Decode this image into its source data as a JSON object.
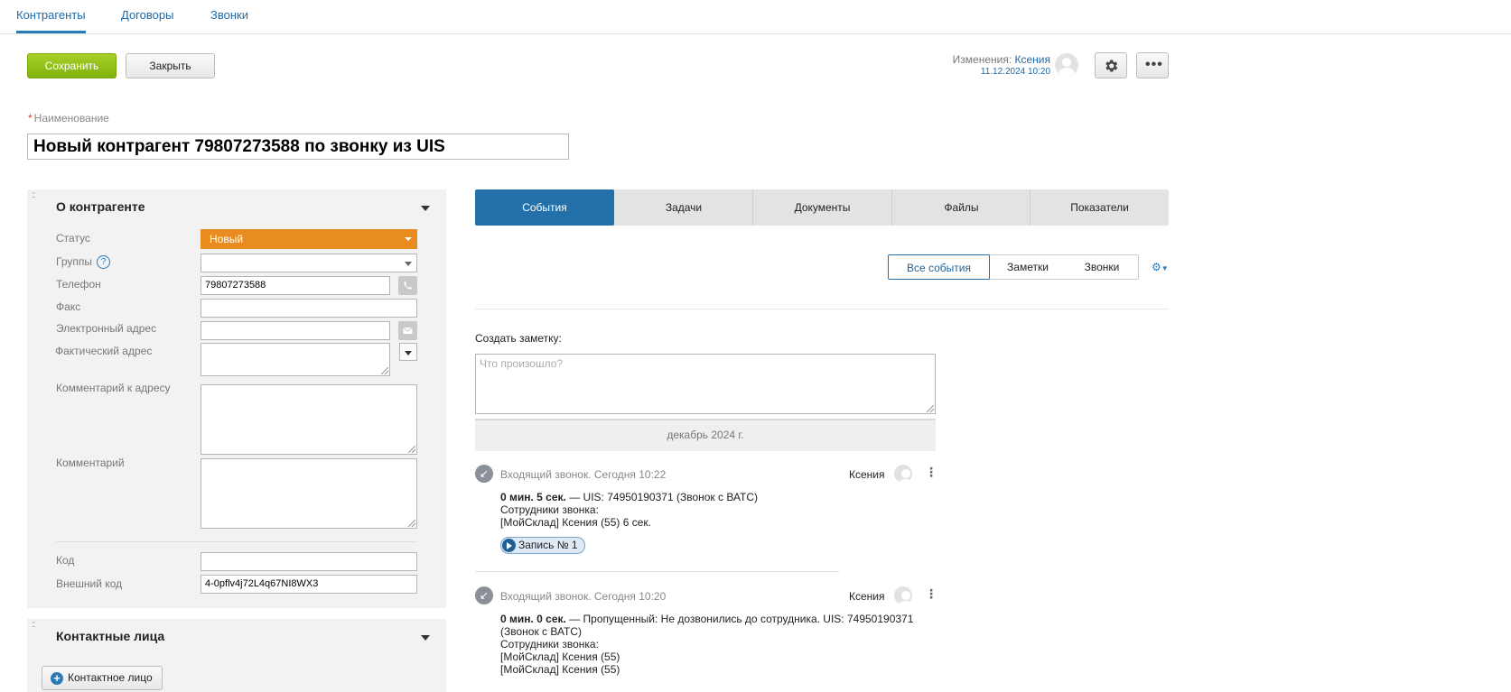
{
  "nav": {
    "tabs": [
      {
        "label": "Контрагенты",
        "active": true
      },
      {
        "label": "Договоры",
        "active": false
      },
      {
        "label": "Звонки",
        "active": false
      }
    ]
  },
  "toolbar": {
    "save_label": "Сохранить",
    "close_label": "Закрыть",
    "save_color": "#8cbd14"
  },
  "changes": {
    "prefix": "Изменения:",
    "user": "Ксения",
    "date": "11.12.2024 10:20"
  },
  "name": {
    "label": "Наименование",
    "required_mark": "*",
    "value": "Новый контрагент 79807273588 по звонку из UIS"
  },
  "about": {
    "title": "О контрагенте",
    "fields": {
      "status_label": "Статус",
      "status_value": "Новый",
      "status_color": "#e98c1f",
      "groups_label": "Группы",
      "groups_help": "?",
      "groups_value": "",
      "phone_label": "Телефон",
      "phone_value": "79807273588",
      "fax_label": "Факс",
      "fax_value": "",
      "email_label": "Электронный адрес",
      "email_value": "",
      "address_label": "Фактический адрес",
      "address_value": "",
      "address_comment_label": "Комментарий к адресу",
      "address_comment_value": "",
      "comment_label": "Комментарий",
      "comment_value": "",
      "code_label": "Код",
      "code_value": "",
      "external_code_label": "Внешний код",
      "external_code_value": "4-0pflv4j72L4q67NI8WX3"
    }
  },
  "contacts": {
    "title": "Контактные лица",
    "add_label": "Контактное лицо"
  },
  "tabs": [
    {
      "label": "События",
      "active": true
    },
    {
      "label": "Задачи",
      "active": false
    },
    {
      "label": "Документы",
      "active": false
    },
    {
      "label": "Файлы",
      "active": false
    },
    {
      "label": "Показатели",
      "active": false
    }
  ],
  "filters": [
    {
      "label": "Все события",
      "active": true
    },
    {
      "label": "Заметки",
      "active": false
    },
    {
      "label": "Звонки",
      "active": false
    }
  ],
  "note": {
    "label": "Создать заметку:",
    "placeholder": "Что произошло?"
  },
  "month_header": "декабрь 2024 г.",
  "events": [
    {
      "icon": "incoming-call-icon",
      "header": "Входящий звонок. Сегодня 10:22",
      "user": "Ксения",
      "duration": "0 мин. 5 сек.",
      "desc": " — UIS: 74950190371 (Звонок с ВАТС)",
      "staff_label": "Сотрудники звонка:",
      "staff": [
        "[МойСклад] Ксения (55) 6 сек."
      ],
      "record_label": "Запись № 1"
    },
    {
      "icon": "incoming-call-icon",
      "header": "Входящий звонок. Сегодня 10:20",
      "user": "Ксения",
      "duration": "0 мин. 0 сек.",
      "desc": " — Пропущенный: Не дозвонились до сотрудника. UIS: 74950190371 (Звонок с ВАТС)",
      "staff_label": "Сотрудники звонка:",
      "staff": [
        "[МойСклад] Ксения (55)",
        "[МойСклад] Ксения (55)"
      ]
    }
  ]
}
